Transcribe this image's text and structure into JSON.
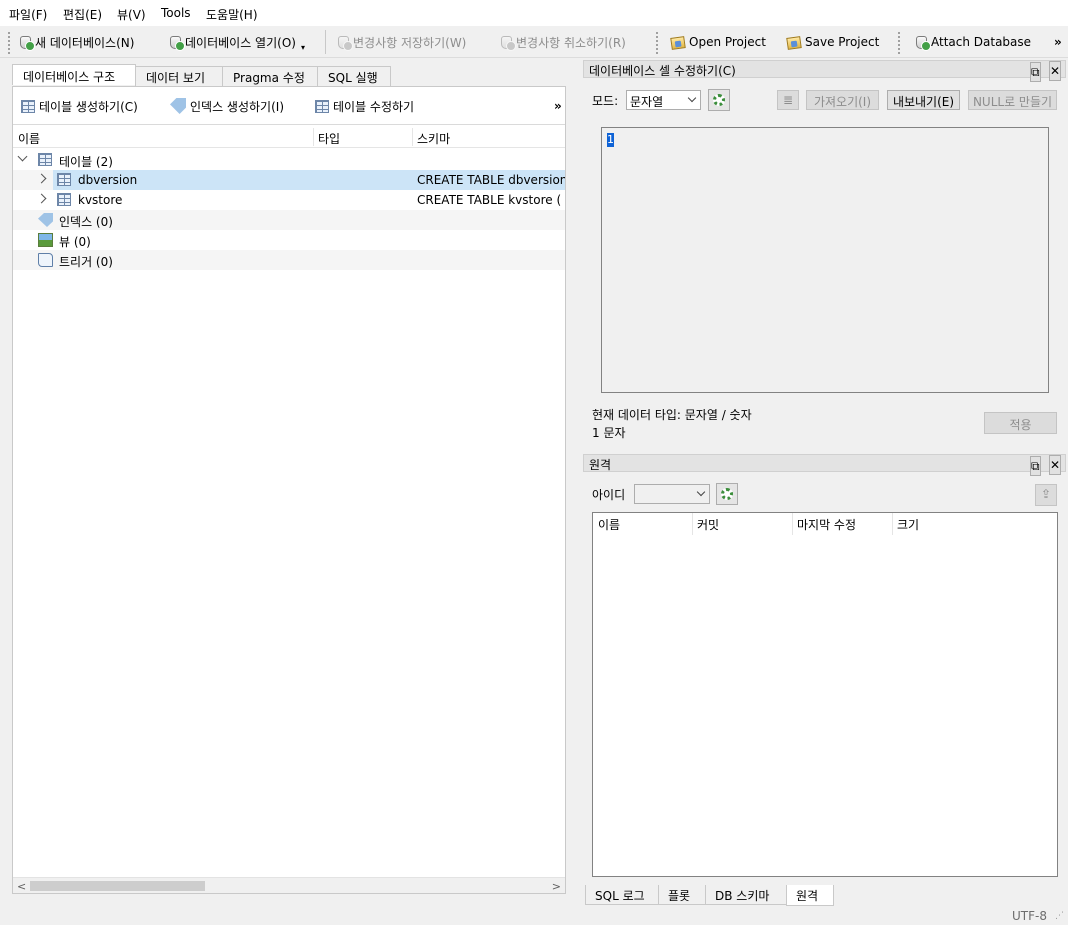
{
  "menu": [
    "파일(F)",
    "편집(E)",
    "뷰(V)",
    "Tools",
    "도움말(H)"
  ],
  "toolbar": {
    "new_db": "새 데이터베이스(N)",
    "open_db": "데이터베이스 열기(O)",
    "write_changes": "변경사항 저장하기(W)",
    "revert_changes": "변경사항 취소하기(R)",
    "open_project": "Open Project",
    "save_project": "Save Project",
    "attach_db": "Attach Database",
    "overflow": "»"
  },
  "left_tabs": [
    "데이터베이스 구조",
    "데이터 보기",
    "Pragma 수정",
    "SQL 실행"
  ],
  "structure_toolbar": {
    "create_table": "테이블 생성하기(C)",
    "create_index": "인덱스 생성하기(I)",
    "modify_table": "테이블 수정하기",
    "overflow": "»"
  },
  "tree": {
    "headers": [
      "이름",
      "타입",
      "스키마"
    ],
    "rows": [
      {
        "name": "테이블 (2)",
        "type": "",
        "schema": ""
      },
      {
        "name": "dbversion",
        "type": "",
        "schema": "CREATE TABLE dbversion (ve"
      },
      {
        "name": "kvstore",
        "type": "",
        "schema": "CREATE TABLE kvstore ( ver"
      },
      {
        "name": "인덱스 (0)",
        "type": "",
        "schema": ""
      },
      {
        "name": "뷰 (0)",
        "type": "",
        "schema": ""
      },
      {
        "name": "트리거 (0)",
        "type": "",
        "schema": ""
      }
    ]
  },
  "edit_cell": {
    "title": "데이터베이스 셀 수정하기(C)",
    "mode_label": "모드:",
    "mode_value": "문자열",
    "import_btn": "가져오기(I)",
    "export_btn": "내보내기(E)",
    "null_btn": "NULL로 만들기",
    "editor_value": "1",
    "type_info": "현재 데이터 타입: 문자열 / 숫자",
    "size_info": "1 문자",
    "apply_btn": "적용"
  },
  "remote": {
    "title": "원격",
    "id_label": "아이디",
    "id_value": "",
    "columns": [
      "이름",
      "커밋",
      "마지막 수정",
      "크기"
    ]
  },
  "bottom_tabs": [
    "SQL 로그",
    "플롯",
    "DB 스키마",
    "원격"
  ],
  "status": {
    "encoding": "UTF-8"
  }
}
